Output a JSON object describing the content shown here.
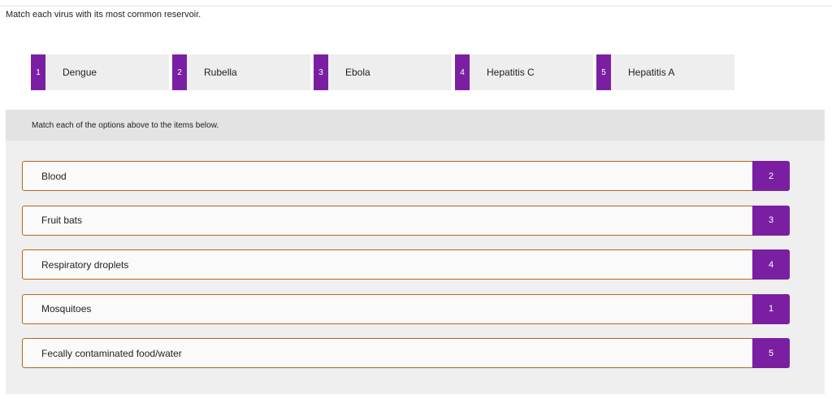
{
  "question": "Match each virus with its most common reservoir.",
  "options": [
    {
      "number": "1",
      "label": "Dengue"
    },
    {
      "number": "2",
      "label": "Rubella"
    },
    {
      "number": "3",
      "label": "Ebola"
    },
    {
      "number": "4",
      "label": "Hepatitis C"
    },
    {
      "number": "5",
      "label": "Hepatitis A"
    }
  ],
  "instructions": "Match each of the options above to the items below.",
  "items": [
    {
      "label": "Blood",
      "answer": "2"
    },
    {
      "label": "Fruit bats",
      "answer": "3"
    },
    {
      "label": "Respiratory droplets",
      "answer": "4"
    },
    {
      "label": "Mosquitoes",
      "answer": "1"
    },
    {
      "label": "Fecally contaminated food/water",
      "answer": "5"
    }
  ],
  "colors": {
    "accent": "#7b1fa2",
    "row_border": "#b5651d"
  }
}
